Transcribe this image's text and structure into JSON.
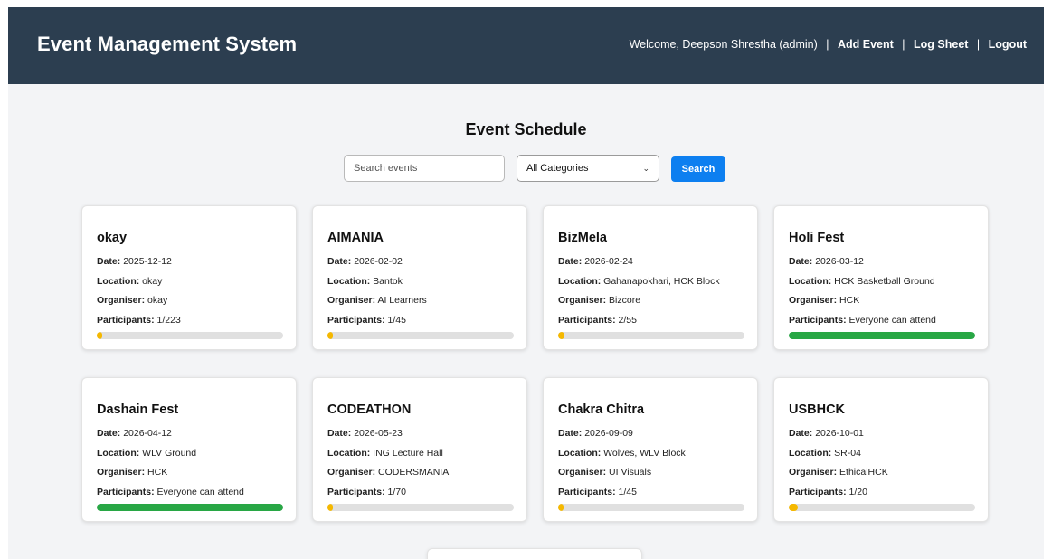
{
  "header": {
    "title": "Event Management System",
    "welcome": "Welcome, Deepson Shrestha (admin)",
    "separator": "|",
    "links": [
      "Add Event",
      "Log Sheet",
      "Logout"
    ]
  },
  "main": {
    "title": "Event Schedule",
    "search_placeholder": "Search events",
    "category_selected": "All Categories",
    "search_button": "Search"
  },
  "labels": {
    "date": "Date:",
    "location": "Location:",
    "organiser": "Organiser:",
    "participants": "Participants:"
  },
  "colors": {
    "header_bg": "#2c3e50",
    "accent_blue": "#0d7ff0",
    "bar_yellow": "#f5b800",
    "bar_green": "#28a745"
  },
  "events": [
    {
      "name": "okay",
      "date": "2025-12-12",
      "location": "okay",
      "organiser": "okay",
      "participants": "1/223",
      "fill": 0.0045,
      "color": "#f5b800"
    },
    {
      "name": "AIMANIA",
      "date": "2026-02-02",
      "location": "Bantok",
      "organiser": "AI Learners",
      "participants": "1/45",
      "fill": 0.022,
      "color": "#f5b800"
    },
    {
      "name": "BizMela",
      "date": "2026-02-24",
      "location": "Gahanapokhari, HCK Block",
      "organiser": "Bizcore",
      "participants": "2/55",
      "fill": 0.036,
      "color": "#f5b800"
    },
    {
      "name": "Holi Fest",
      "date": "2026-03-12",
      "location": "HCK Basketball Ground",
      "organiser": "HCK",
      "participants": "Everyone can attend",
      "fill": 1,
      "color": "#28a745"
    },
    {
      "name": "Dashain Fest",
      "date": "2026-04-12",
      "location": "WLV Ground",
      "organiser": "HCK",
      "participants": "Everyone can attend",
      "fill": 1,
      "color": "#28a745"
    },
    {
      "name": "CODEATHON",
      "date": "2026-05-23",
      "location": "ING Lecture Hall",
      "organiser": "CODERSMANIA",
      "participants": "1/70",
      "fill": 0.014,
      "color": "#f5b800"
    },
    {
      "name": "Chakra Chitra",
      "date": "2026-09-09",
      "location": "Wolves, WLV Block",
      "organiser": "UI Visuals",
      "participants": "1/45",
      "fill": 0.022,
      "color": "#f5b800"
    },
    {
      "name": "USBHCK",
      "date": "2026-10-01",
      "location": "SR-04",
      "organiser": "EthicalHCK",
      "participants": "1/20",
      "fill": 0.05,
      "color": "#f5b800"
    }
  ]
}
